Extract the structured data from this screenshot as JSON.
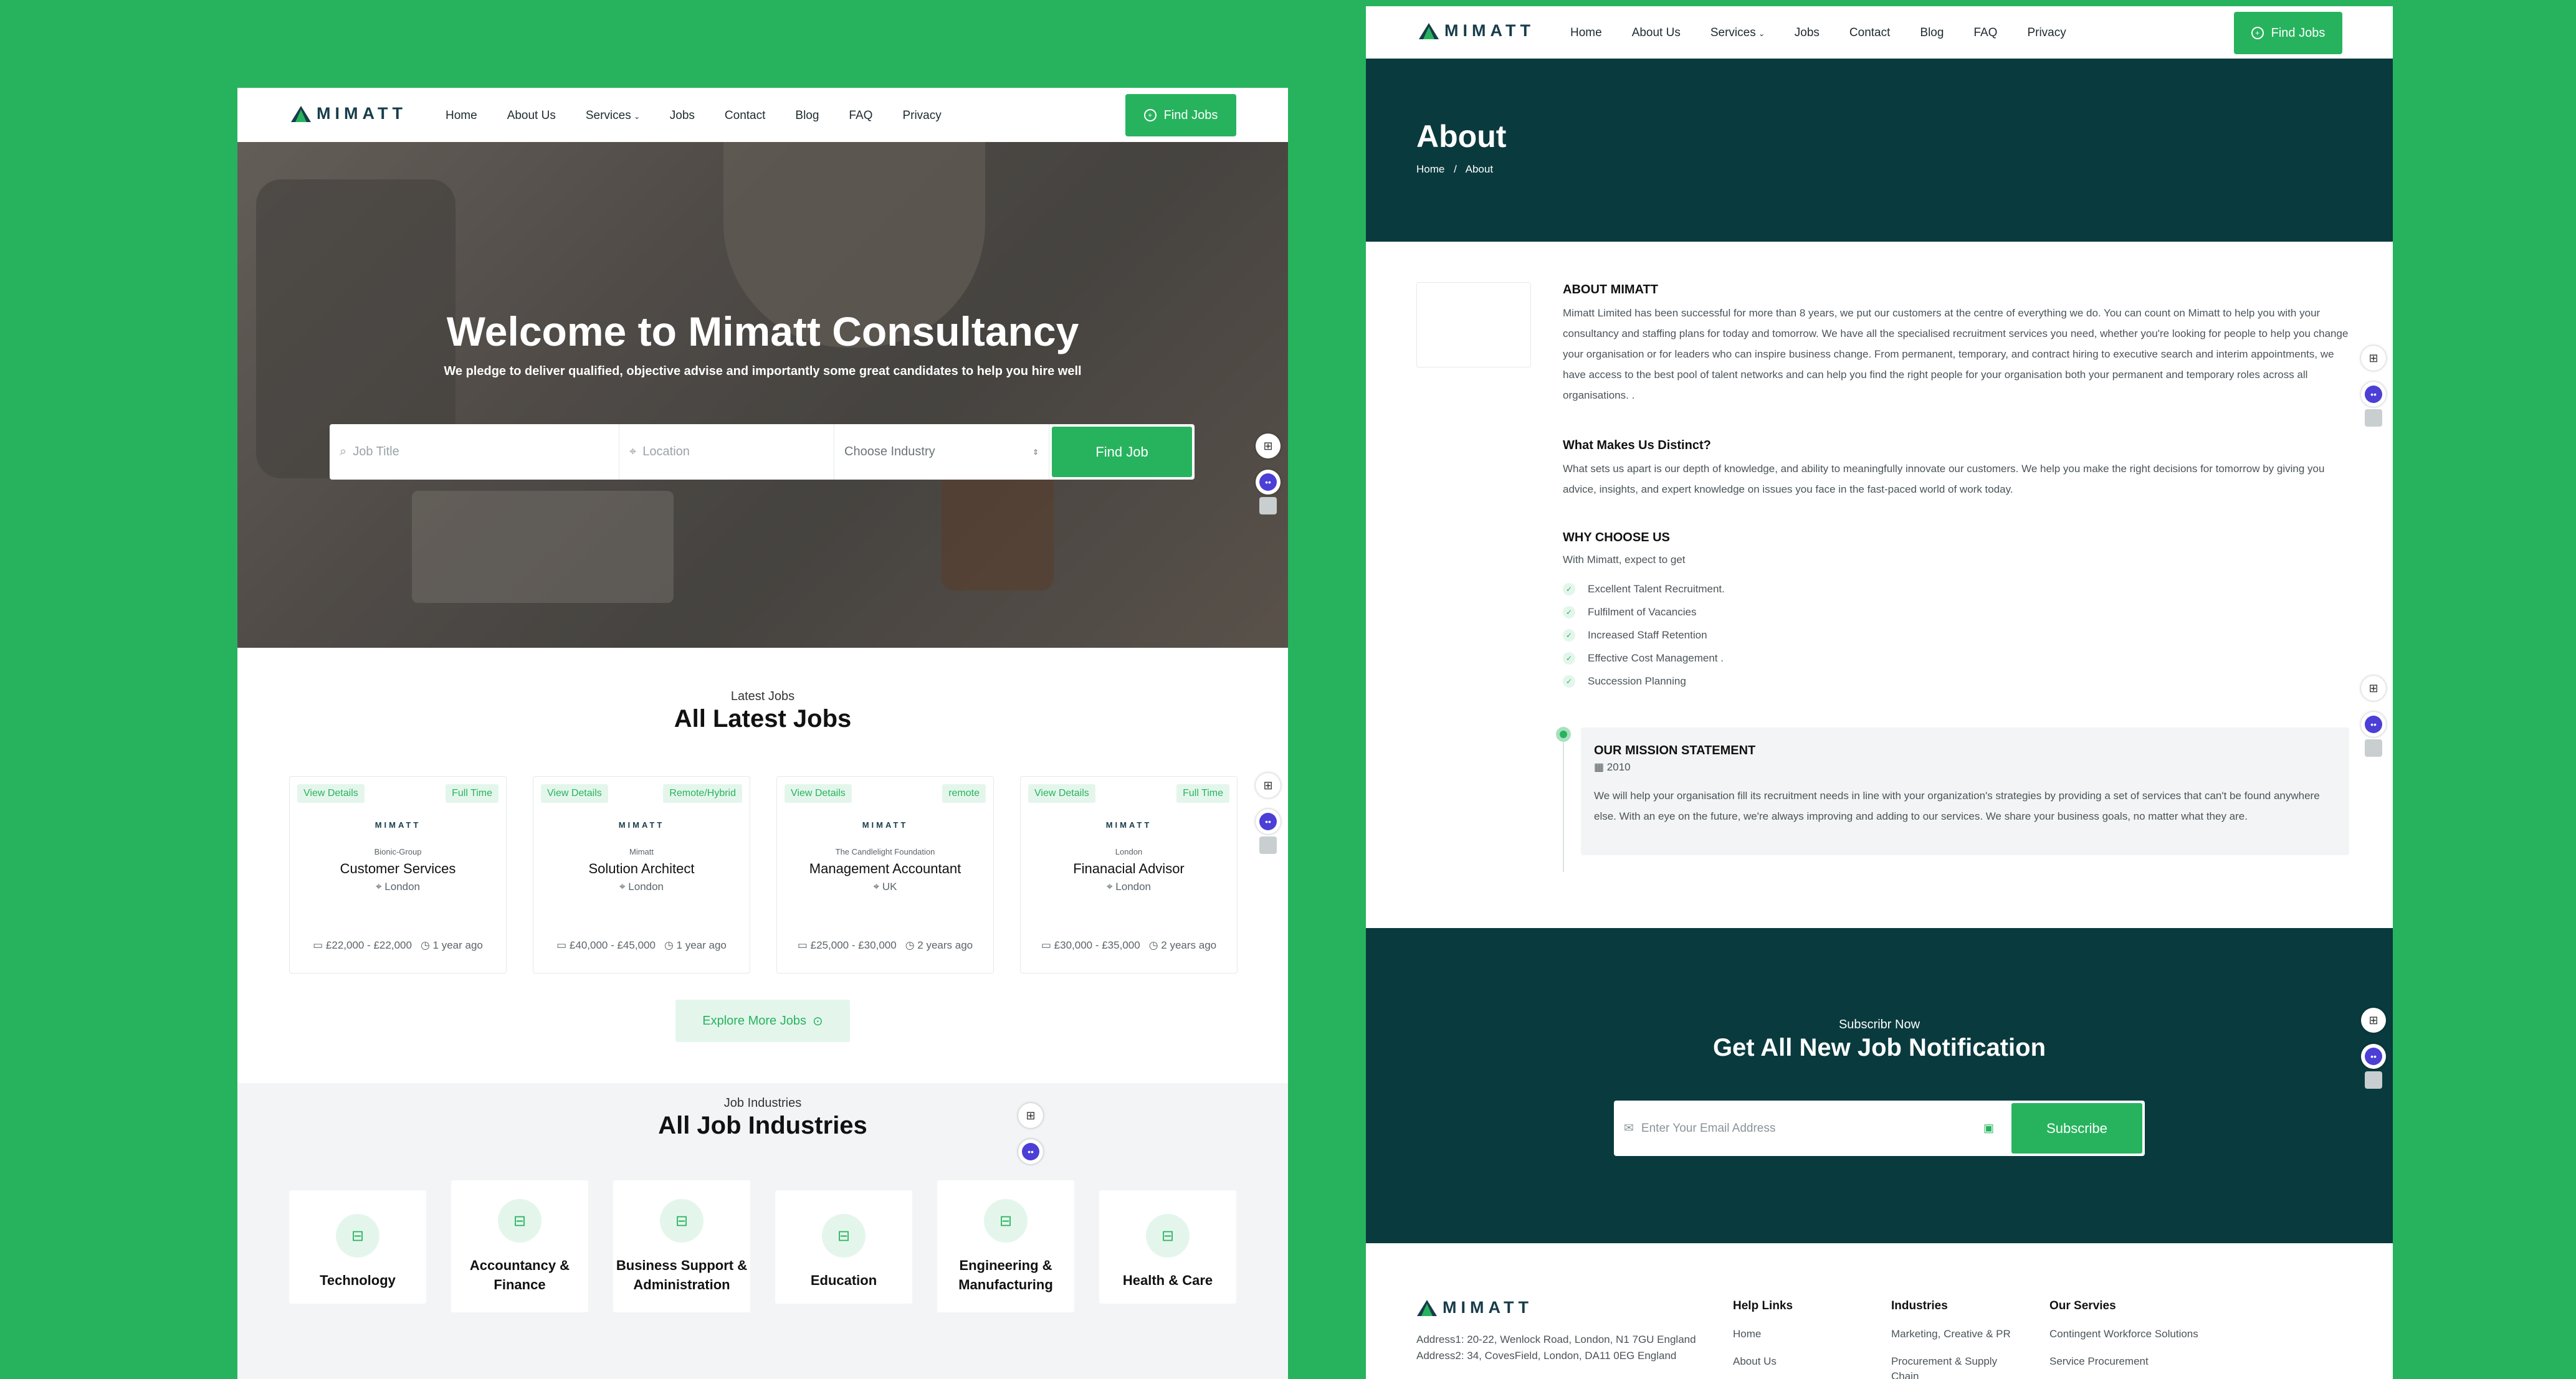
{
  "brand": {
    "logo_text": "MIMATT",
    "accent": "#27b35d",
    "dark": "#093a3e"
  },
  "nav": {
    "items": [
      "Home",
      "About Us",
      "Services",
      "Jobs",
      "Contact",
      "Blog",
      "FAQ",
      "Privacy"
    ],
    "find_jobs": "Find Jobs"
  },
  "hero": {
    "title": "Welcome to Mimatt Consultancy",
    "subtitle": "We pledge to deliver qualified, objective advise and importantly some great candidates to help you hire well",
    "job_title_placeholder": "Job Title",
    "location_placeholder": "Location",
    "industry_select": "Choose Industry",
    "find_button": "Find Job"
  },
  "latest": {
    "subtitle": "Latest Jobs",
    "title": "All Latest Jobs",
    "view_details": "View Details",
    "jobs": [
      {
        "type": "Full Time",
        "company": "Bionic-Group",
        "role": "Customer Services",
        "location": "London",
        "salary": "£22,000 - £22,000",
        "posted": "1 year ago"
      },
      {
        "type": "Remote/Hybrid",
        "company": "Mimatt",
        "role": "Solution Architect",
        "location": "London",
        "salary": "£40,000 - £45,000",
        "posted": "1 year ago"
      },
      {
        "type": "remote",
        "company": "The Candlelight Foundation",
        "role": "Management Accountant",
        "location": "UK",
        "salary": "£25,000 - £30,000",
        "posted": "2 years ago"
      },
      {
        "type": "Full Time",
        "company": "London",
        "role": "Finanacial Advisor",
        "location": "London",
        "salary": "£30,000 - £35,000",
        "posted": "2 years ago"
      }
    ],
    "explore": "Explore More Jobs"
  },
  "industries": {
    "subtitle": "Job Industries",
    "title": "All Job Industries",
    "items": [
      {
        "line1": "Technology",
        "line2": ""
      },
      {
        "line1": "Accountancy &",
        "line2": "Finance"
      },
      {
        "line1": "Business Support &",
        "line2": "Administration"
      },
      {
        "line1": "Education",
        "line2": ""
      },
      {
        "line1": "Engineering &",
        "line2": "Manufacturing"
      },
      {
        "line1": "Health & Care",
        "line2": ""
      }
    ]
  },
  "about": {
    "title": "About",
    "crumb_home": "Home",
    "crumb_sep": "/",
    "crumb_current": "About",
    "h1": "ABOUT MIMATT",
    "p1": "Mimatt Limited has been successful for more than 8 years, we put our customers at the centre of everything we do. You can count on Mimatt to help you with your consultancy and staffing plans for today and tomorrow. We have all the specialised recruitment services you need, whether you're looking for people to help you change your organisation or for leaders who can inspire business change. From permanent, temporary, and contract hiring to executive search and interim appointments, we have access to the best pool of talent networks and can help you find the right people for your organisation both your permanent and temporary roles across all organisations. .",
    "h2": "What Makes Us Distinct?",
    "p2": "What sets us apart is our depth of knowledge, and ability to meaningfully innovate our customers. We help you make the right decisions for tomorrow by giving you advice, insights, and expert knowledge on issues you face in the fast-paced world of work today.",
    "h3": "WHY CHOOSE US",
    "p3": "With Mimatt, expect to get",
    "list": [
      "Excellent Talent Recruitment.",
      "Fulfilment of Vacancies",
      "Increased Staff Retention",
      "Effective Cost Management .",
      "Succession Planning"
    ],
    "mission_title": "OUR MISSION STATEMENT",
    "mission_year": "2010",
    "mission_text": "We will help your organisation fill its recruitment needs in line with your organization's strategies by providing a set of services that can't be found anywhere else. With an eye on the future, we're always improving and adding to our services. We share your business goals, no matter what they are."
  },
  "subscribe": {
    "subtitle": "Subscribr Now",
    "title": "Get All New Job Notification",
    "placeholder": "Enter Your Email Address",
    "button": "Subscribe"
  },
  "footer": {
    "address1": "Address1: 20-22, Wenlock Road, London, N1 7GU England",
    "address2": "Address2: 34, CovesField, London, DA11 0EG England",
    "help_title": "Help Links",
    "help": [
      "Home",
      "About Us"
    ],
    "ind_title": "Industries",
    "ind": [
      "Marketing, Creative & PR",
      "Procurement & Supply Chain"
    ],
    "serv_title": "Our Servies",
    "serv": [
      "Contingent Workforce Solutions",
      "Service Procurement"
    ]
  }
}
